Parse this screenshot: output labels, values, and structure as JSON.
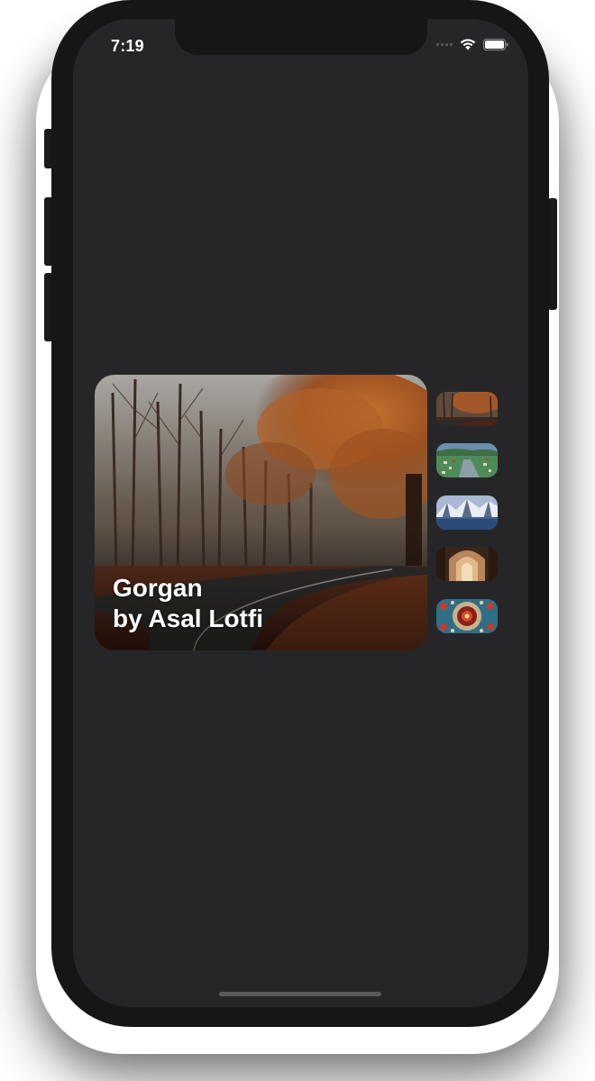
{
  "status_bar": {
    "time": "7:19",
    "signal_icon": "cellular-signal-icon",
    "wifi_icon": "wifi-icon",
    "battery_icon": "battery-icon"
  },
  "gallery": {
    "featured": {
      "title": "Gorgan",
      "author": "by Asal Lotfi",
      "image": "autumn-forest-road-photo"
    },
    "thumbnails": [
      {
        "image": "autumn-forest-road-photo"
      },
      {
        "image": "green-valley-village-photo"
      },
      {
        "image": "snowy-mountain-lake-photo"
      },
      {
        "image": "arched-corridor-photo"
      },
      {
        "image": "ornate-tile-dome-photo"
      }
    ]
  },
  "colors": {
    "screen_background": "#262628",
    "device_frame": "#161616",
    "text": "#ffffff"
  }
}
